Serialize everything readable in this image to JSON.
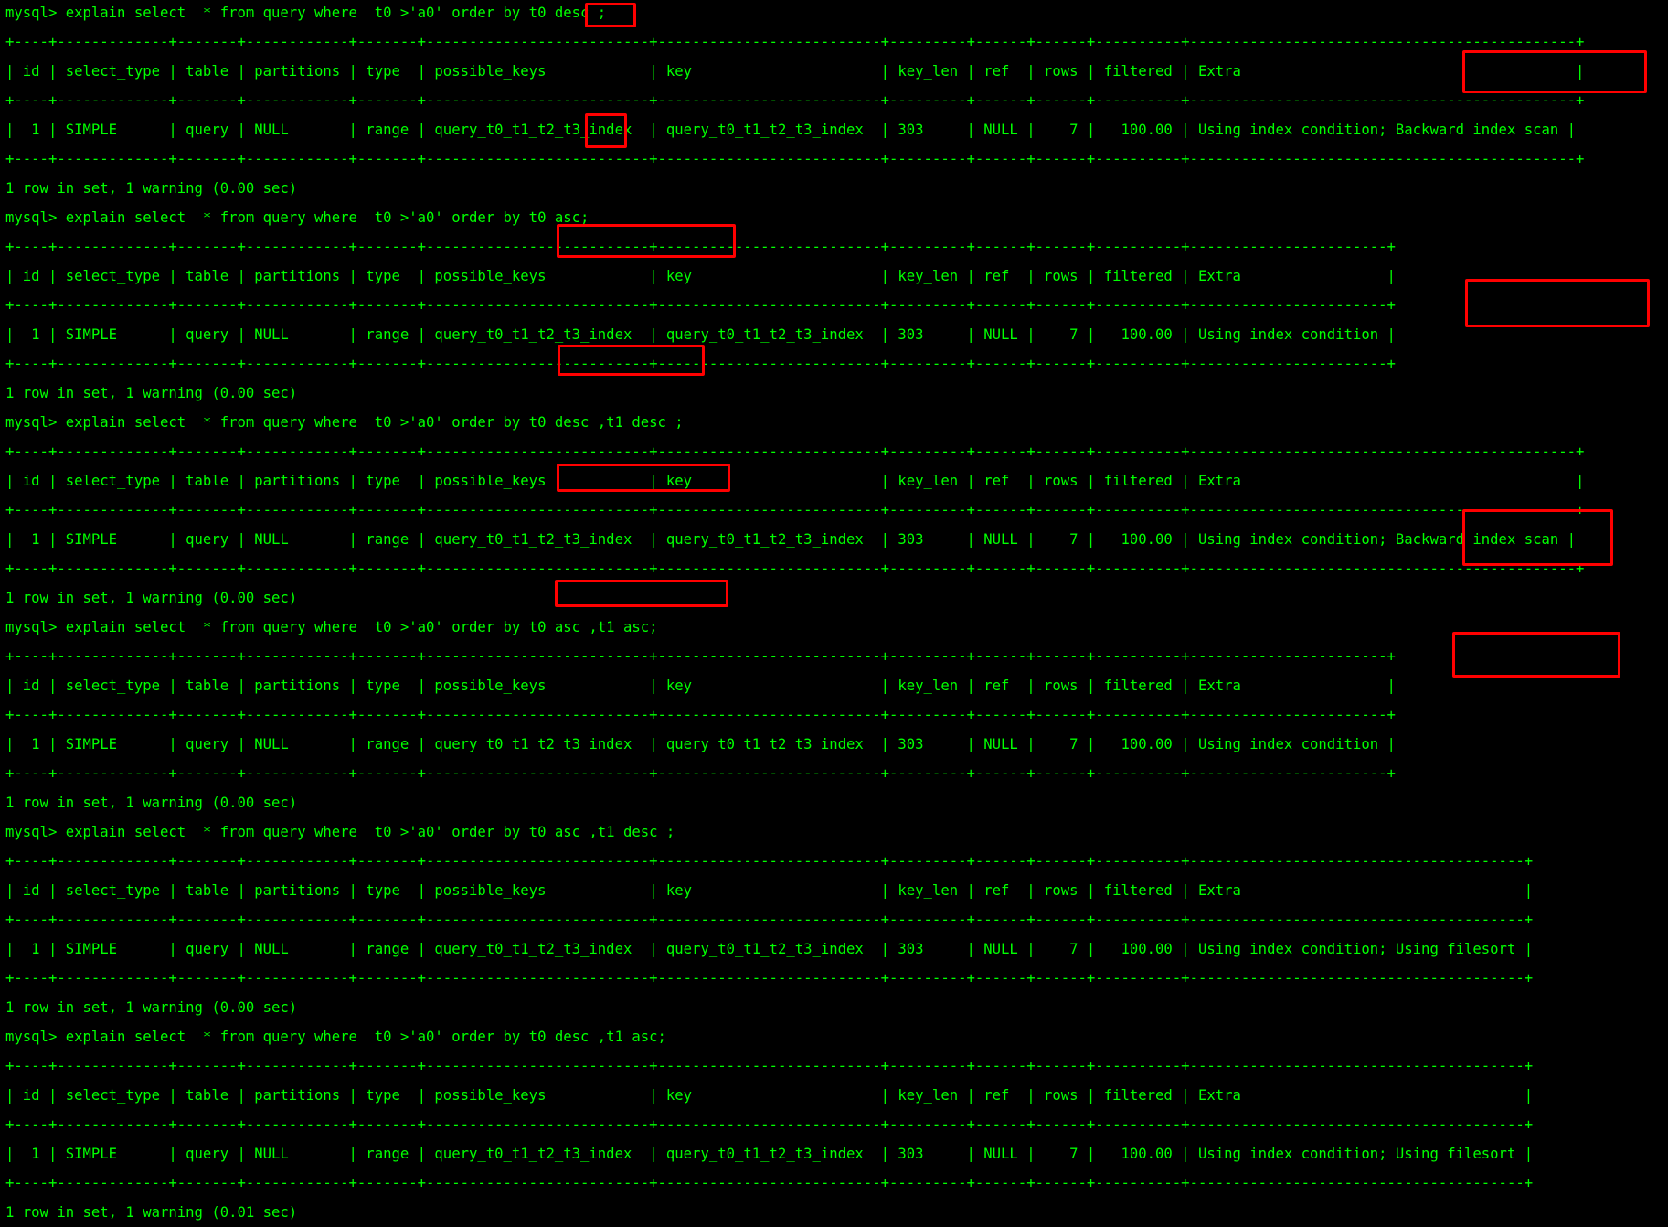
{
  "terminal": {
    "foreground": "#00ff00",
    "background": "#000000",
    "highlight_color": "#ff0000",
    "lines": [
      "mysql> explain select  * from query where  t0 >'a0' order by t0 desc ;",
      "+----+-------------+-------+------------+-------+--------------------------+--------------------------+---------+------+------+----------+---------------------------------------------+",
      "| id | select_type | table | partitions | type  | possible_keys            | key                      | key_len | ref  | rows | filtered | Extra                                       |",
      "+----+-------------+-------+------------+-------+--------------------------+--------------------------+---------+------+------+----------+---------------------------------------------+",
      "|  1 | SIMPLE      | query | NULL       | range | query_t0_t1_t2_t3_index  | query_t0_t1_t2_t3_index  | 303     | NULL |    7 |   100.00 | Using index condition; Backward index scan |",
      "+----+-------------+-------+------------+-------+--------------------------+--------------------------+---------+------+------+----------+---------------------------------------------+",
      "1 row in set, 1 warning (0.00 sec)",
      "mysql> explain select  * from query where  t0 >'a0' order by t0 asc;",
      "+----+-------------+-------+------------+-------+--------------------------+--------------------------+---------+------+------+----------+-----------------------+",
      "| id | select_type | table | partitions | type  | possible_keys            | key                      | key_len | ref  | rows | filtered | Extra                 |",
      "+----+-------------+-------+------------+-------+--------------------------+--------------------------+---------+------+------+----------+-----------------------+",
      "|  1 | SIMPLE      | query | NULL       | range | query_t0_t1_t2_t3_index  | query_t0_t1_t2_t3_index  | 303     | NULL |    7 |   100.00 | Using index condition |",
      "+----+-------------+-------+------------+-------+--------------------------+--------------------------+---------+------+------+----------+-----------------------+",
      "1 row in set, 1 warning (0.00 sec)",
      "mysql> explain select  * from query where  t0 >'a0' order by t0 desc ,t1 desc ;",
      "+----+-------------+-------+------------+-------+--------------------------+--------------------------+---------+------+------+----------+---------------------------------------------+",
      "| id | select_type | table | partitions | type  | possible_keys            | key                      | key_len | ref  | rows | filtered | Extra                                       |",
      "+----+-------------+-------+------------+-------+--------------------------+--------------------------+---------+------+------+----------+---------------------------------------------+",
      "|  1 | SIMPLE      | query | NULL       | range | query_t0_t1_t2_t3_index  | query_t0_t1_t2_t3_index  | 303     | NULL |    7 |   100.00 | Using index condition; Backward index scan |",
      "+----+-------------+-------+------------+-------+--------------------------+--------------------------+---------+------+------+----------+---------------------------------------------+",
      "1 row in set, 1 warning (0.00 sec)",
      "mysql> explain select  * from query where  t0 >'a0' order by t0 asc ,t1 asc;",
      "+----+-------------+-------+------------+-------+--------------------------+--------------------------+---------+------+------+----------+-----------------------+",
      "| id | select_type | table | partitions | type  | possible_keys            | key                      | key_len | ref  | rows | filtered | Extra                 |",
      "+----+-------------+-------+------------+-------+--------------------------+--------------------------+---------+------+------+----------+-----------------------+",
      "|  1 | SIMPLE      | query | NULL       | range | query_t0_t1_t2_t3_index  | query_t0_t1_t2_t3_index  | 303     | NULL |    7 |   100.00 | Using index condition |",
      "+----+-------------+-------+------------+-------+--------------------------+--------------------------+---------+------+------+----------+-----------------------+",
      "1 row in set, 1 warning (0.00 sec)",
      "mysql> explain select  * from query where  t0 >'a0' order by t0 asc ,t1 desc ;",
      "+----+-------------+-------+------------+-------+--------------------------+--------------------------+---------+------+------+----------+---------------------------------------+",
      "| id | select_type | table | partitions | type  | possible_keys            | key                      | key_len | ref  | rows | filtered | Extra                                 |",
      "+----+-------------+-------+------------+-------+--------------------------+--------------------------+---------+------+------+----------+---------------------------------------+",
      "|  1 | SIMPLE      | query | NULL       | range | query_t0_t1_t2_t3_index  | query_t0_t1_t2_t3_index  | 303     | NULL |    7 |   100.00 | Using index condition; Using filesort |",
      "+----+-------------+-------+------------+-------+--------------------------+--------------------------+---------+------+------+----------+---------------------------------------+",
      "1 row in set, 1 warning (0.00 sec)",
      "mysql> explain select  * from query where  t0 >'a0' order by t0 desc ,t1 asc;",
      "+----+-------------+-------+------------+-------+--------------------------+--------------------------+---------+------+------+----------+---------------------------------------+",
      "| id | select_type | table | partitions | type  | possible_keys            | key                      | key_len | ref  | rows | filtered | Extra                                 |",
      "+----+-------------+-------+------------+-------+--------------------------+--------------------------+---------+------+------+----------+---------------------------------------+",
      "|  1 | SIMPLE      | query | NULL       | range | query_t0_t1_t2_t3_index  | query_t0_t1_t2_t3_index  | 303     | NULL |    7 |   100.00 | Using index condition; Using filesort |",
      "+----+-------------+-------+------------+-------+--------------------------+--------------------------+---------+------+------+----------+---------------------------------------+",
      "1 row in set, 1 warning (0.01 sec)"
    ]
  }
}
